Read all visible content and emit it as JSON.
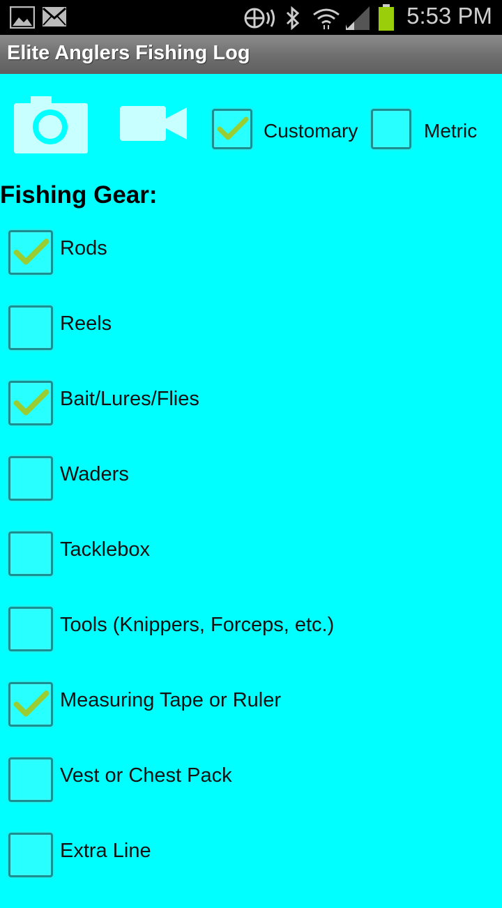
{
  "status_bar": {
    "time": "5:53 PM"
  },
  "app": {
    "title": "Elite Anglers Fishing Log"
  },
  "units": {
    "customary": {
      "label": "Customary",
      "checked": true
    },
    "metric": {
      "label": "Metric",
      "checked": false
    }
  },
  "gear": {
    "heading": "Fishing Gear:",
    "items": [
      {
        "label": "Rods",
        "checked": true
      },
      {
        "label": "Reels",
        "checked": false
      },
      {
        "label": "Bait/Lures/Flies",
        "checked": true
      },
      {
        "label": "Waders",
        "checked": false
      },
      {
        "label": "Tacklebox",
        "checked": false
      },
      {
        "label": "Tools (Knippers, Forceps, etc.)",
        "checked": false
      },
      {
        "label": "Measuring Tape or Ruler",
        "checked": true
      },
      {
        "label": "Vest or Chest Pack",
        "checked": false
      },
      {
        "label": "Extra Line",
        "checked": false
      }
    ]
  },
  "colors": {
    "background": "#00ffff",
    "check": "#9acd32",
    "titlebar": "#7a7a7a"
  }
}
